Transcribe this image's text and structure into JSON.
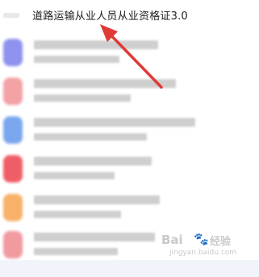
{
  "top_result": {
    "title": "道路运输从业人员从业资格证3.0"
  },
  "colors": {
    "arrow": "#e03a37",
    "blur_bar": "#cfcfcf",
    "bottom_strip": "#f1f5fb"
  },
  "list_items": [
    {
      "icon_color": "#8f92ee"
    },
    {
      "icon_color": "#f3a2a6"
    },
    {
      "icon_color": "#7ba7ef"
    },
    {
      "icon_color": "#ef5e66"
    },
    {
      "icon_color": "#f7b168"
    },
    {
      "icon_color": "#f19aa0"
    }
  ],
  "watermark": {
    "brand": "Bai",
    "paw": "🐾",
    "suffix": "经验",
    "url": "jingyan.baidu.com"
  }
}
